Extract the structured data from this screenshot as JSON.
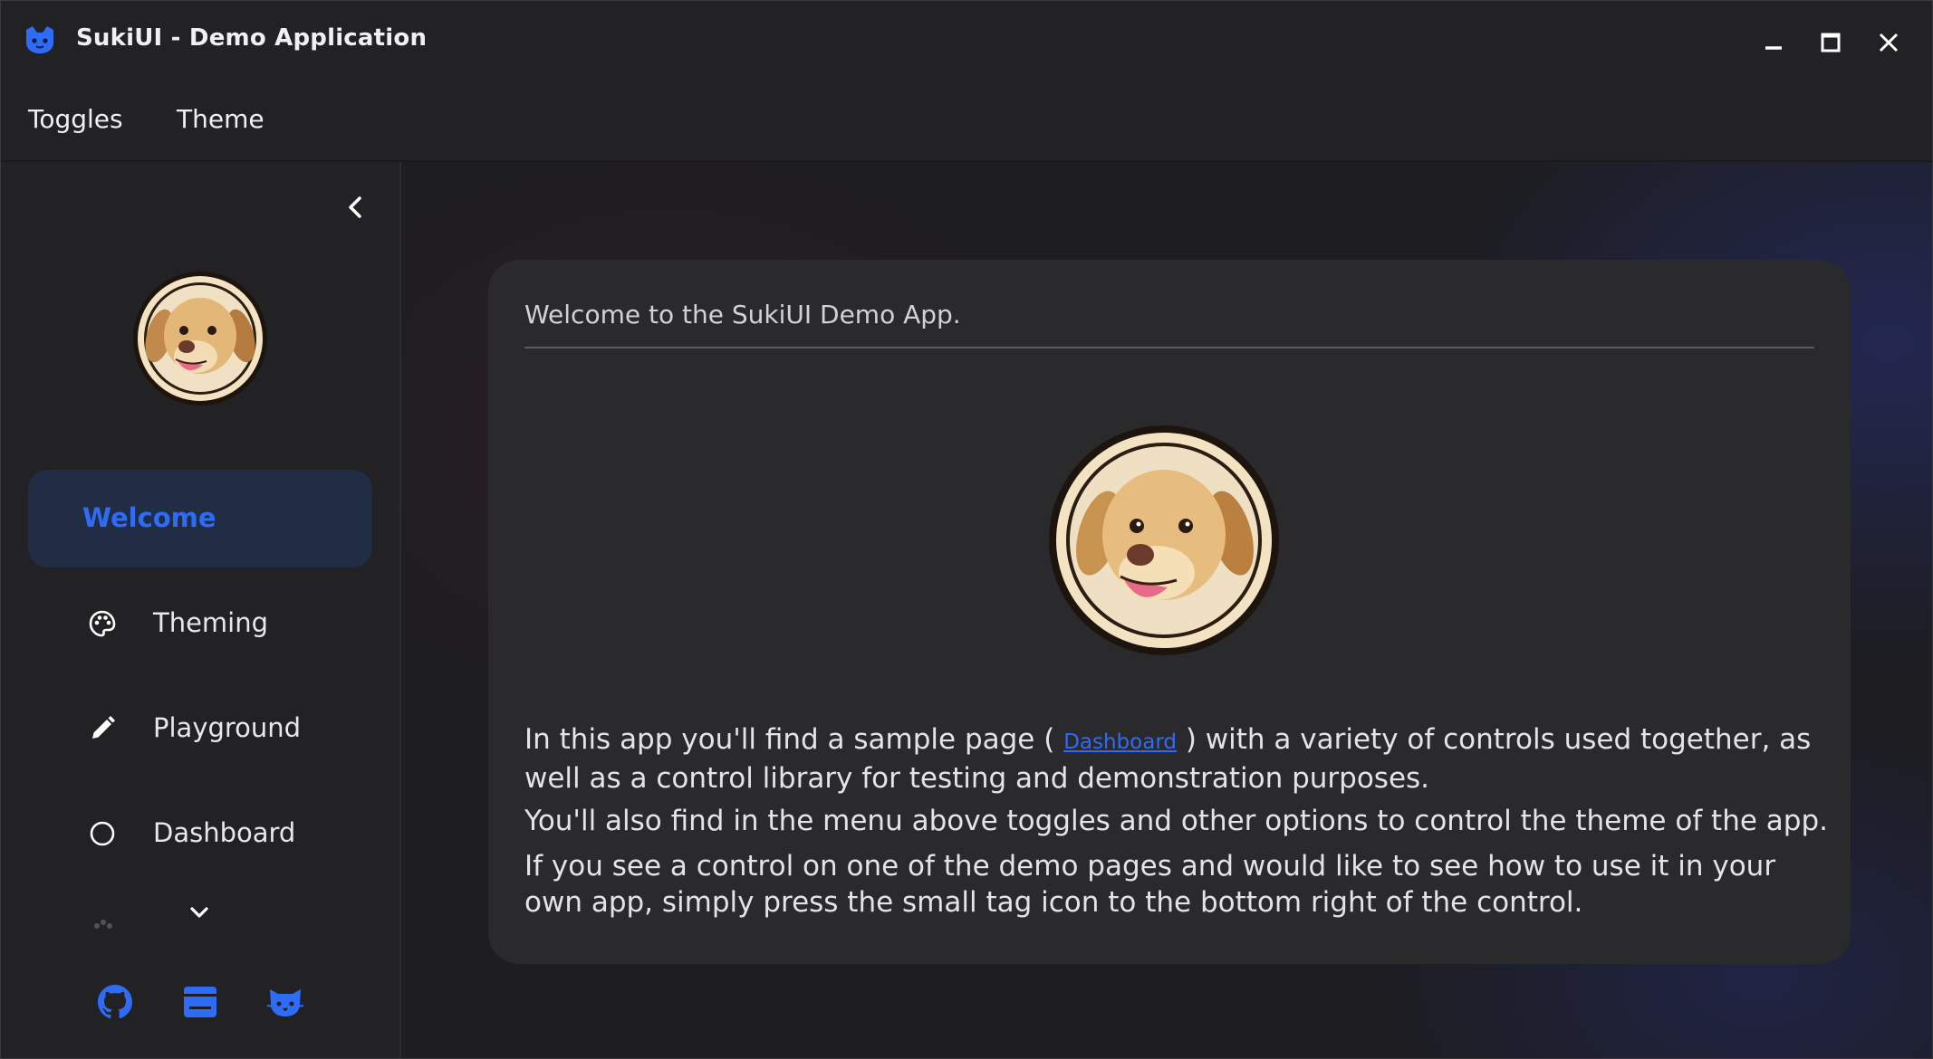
{
  "window": {
    "title": "SukiUI - Demo Application"
  },
  "menu": {
    "items": [
      {
        "label": "Toggles"
      },
      {
        "label": "Theme"
      }
    ]
  },
  "sidebar": {
    "items": [
      {
        "label": "Welcome",
        "icon": "none",
        "active": true
      },
      {
        "label": "Theming",
        "icon": "palette-icon"
      },
      {
        "label": "Playground",
        "icon": "pencil-icon"
      },
      {
        "label": "Dashboard",
        "icon": "circle-icon"
      }
    ],
    "footer_icons": [
      "github-icon",
      "window-icon",
      "cat-icon"
    ]
  },
  "card": {
    "title": "Welcome to the SukiUI Demo App.",
    "para1_before": "In this app you'll find a sample page ( ",
    "para1_link": "Dashboard",
    "para1_after": " ) with a variety of controls used together, as well as a control library for testing and demonstration purposes.",
    "para2": "You'll also find in the menu above toggles and other options to control the theme of the app.",
    "para3": "If you see a control on one of the demo pages and would like to see how to use it in your own app, simply press the small tag icon to the bottom right of the control."
  },
  "colors": {
    "accent": "#2f6cf5",
    "background": "#222225",
    "card": "#2a292c",
    "active_nav_bg": "#212c45"
  }
}
